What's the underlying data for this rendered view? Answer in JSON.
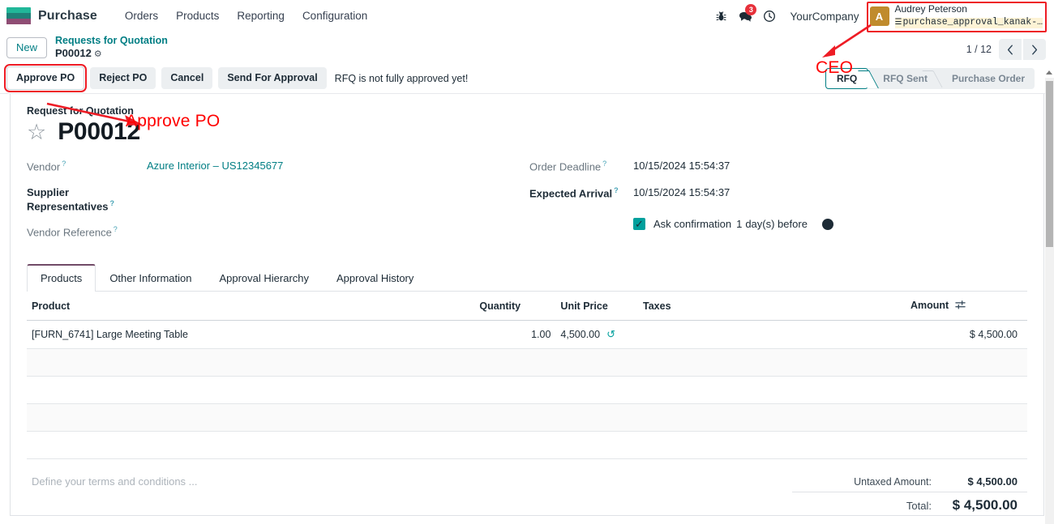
{
  "navbar": {
    "brand": "Purchase",
    "menus": [
      "Orders",
      "Products",
      "Reporting",
      "Configuration"
    ],
    "systray": {
      "bug_icon": "bug-icon",
      "messages_icon": "chat-bubble-icon",
      "messages_count": "3",
      "activities_icon": "clock-icon",
      "company": "YourCompany"
    },
    "user": {
      "avatar_initial": "A",
      "name": "Audrey Peterson",
      "database": "purchase_approval_kanak-…",
      "db_icon": "database-icon"
    }
  },
  "control_panel": {
    "new_label": "New",
    "breadcrumb_parent": "Requests for Quotation",
    "breadcrumb_current": "P00012",
    "gear_icon": "gear-icon",
    "pager": {
      "count": "1 / 12",
      "prev_icon": "chevron-left-icon",
      "next_icon": "chevron-right-icon"
    },
    "buttons": [
      {
        "label": "Approve PO",
        "highlighted": true
      },
      {
        "label": "Reject PO",
        "highlighted": false
      },
      {
        "label": "Cancel",
        "highlighted": false
      },
      {
        "label": "Send For Approval",
        "highlighted": false
      }
    ],
    "warning": "RFQ is not fully approved yet!",
    "statusbar": [
      {
        "label": "RFQ",
        "active": true
      },
      {
        "label": "RFQ Sent",
        "active": false
      },
      {
        "label": "Purchase Order",
        "active": false
      }
    ]
  },
  "form": {
    "subtitle": "Request for Quotation",
    "star_icon": "star-outline-icon",
    "record_name": "P00012",
    "left_fields": [
      {
        "label": "Vendor",
        "value": "Azure Interior – US12345677",
        "link": true,
        "required": false
      },
      {
        "label": "Supplier Representatives",
        "value": "",
        "link": false,
        "required": true
      },
      {
        "label": "Vendor Reference",
        "value": "",
        "link": false,
        "required": false
      }
    ],
    "right_fields": [
      {
        "label": "Order Deadline",
        "value": "10/15/2024 15:54:37",
        "required": false
      },
      {
        "label": "Expected Arrival",
        "value": "10/15/2024 15:54:37",
        "required": true
      }
    ],
    "confirmation": {
      "checked": true,
      "check_icon": "check-icon",
      "prefix": "Ask confirmation",
      "days": "1",
      "suffix": "day(s) before",
      "info_icon": "info-icon"
    }
  },
  "notebook": {
    "tabs": [
      {
        "label": "Products",
        "active": true
      },
      {
        "label": "Other Information",
        "active": false
      },
      {
        "label": "Approval Hierarchy",
        "active": false
      },
      {
        "label": "Approval History",
        "active": false
      }
    ],
    "columns": {
      "product": "Product",
      "quantity": "Quantity",
      "unit_price": "Unit Price",
      "taxes": "Taxes",
      "amount": "Amount",
      "optional_icon": "sliders-icon"
    },
    "rows": [
      {
        "product": "[FURN_6741] Large Meeting Table",
        "quantity": "1.00",
        "unit_price": "4,500.00",
        "reset_icon": "history-reset-icon",
        "taxes": "",
        "amount": "$ 4,500.00"
      }
    ],
    "empty_row_count": 4
  },
  "footer": {
    "terms_placeholder": "Define your terms and conditions ...",
    "untaxed_label": "Untaxed Amount:",
    "untaxed_value": "$ 4,500.00",
    "total_label": "Total:",
    "total_value": "$ 4,500.00"
  },
  "annotations": [
    {
      "name": "ceo-annotation",
      "text": "CEO"
    },
    {
      "name": "approve-po-annotation",
      "text": "Approve PO"
    }
  ],
  "colors": {
    "accent_teal": "#017e84",
    "brand_purple": "#714b67",
    "annotation_red": "#ee1c25",
    "badge_red": "#e7313b",
    "checkbox_teal": "#00a09d"
  }
}
